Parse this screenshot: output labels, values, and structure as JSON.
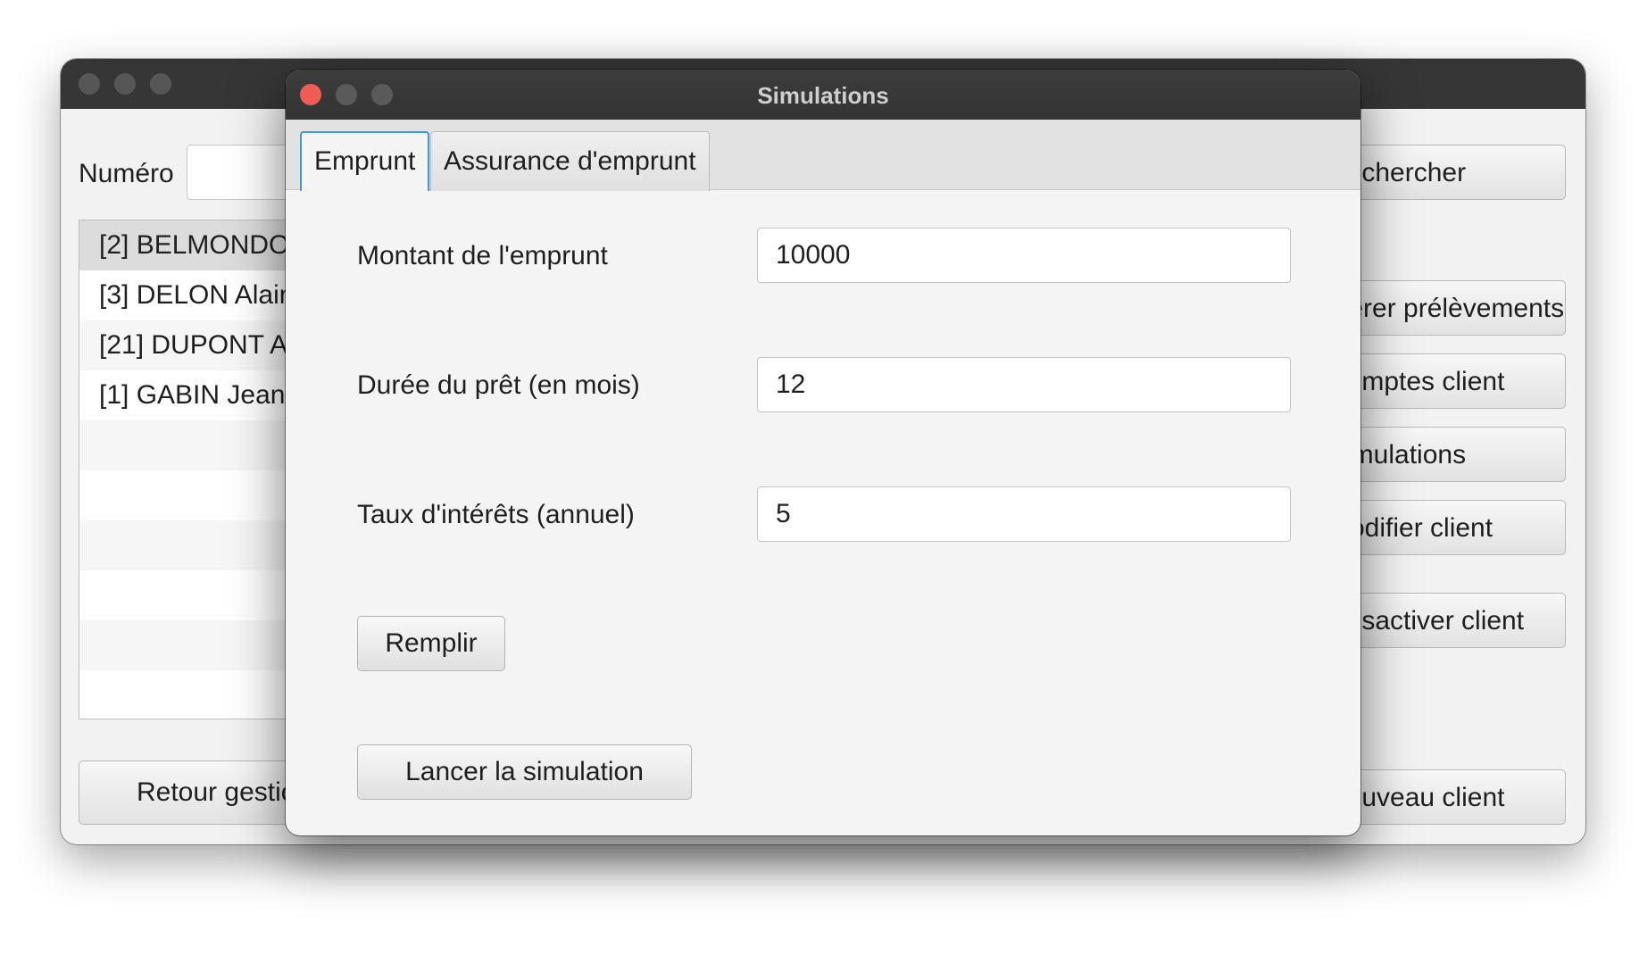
{
  "background_window": {
    "numero_label": "Numéro",
    "numero_value": "",
    "client_list": [
      "[2]  BELMONDO",
      "[3]  DELON Alain",
      "[21]  DUPONT A",
      "[1]  GABIN Jean"
    ],
    "left_button_label": "Retour gestion",
    "right_buttons": [
      "Rechercher",
      "Gérer prélèvements",
      "Comptes client",
      "Simulations",
      "Modifier client",
      "Désactiver client",
      "Nouveau client"
    ]
  },
  "dialog": {
    "title": "Simulations",
    "tabs": [
      {
        "label": "Emprunt",
        "active": true
      },
      {
        "label": "Assurance d'emprunt",
        "active": false
      }
    ],
    "fields": {
      "montant": {
        "label": "Montant de l'emprunt",
        "value": "10000"
      },
      "duree": {
        "label": "Durée du prêt (en mois)",
        "value": "12"
      },
      "taux": {
        "label": "Taux d'intérêts (annuel)",
        "value": "5"
      }
    },
    "remplir_label": "Remplir",
    "lancer_label": "Lancer la simulation"
  },
  "colors": {
    "titlebar": "#363636",
    "close_dot": "#ee5c55",
    "tab_focus": "#3b9ae1"
  }
}
